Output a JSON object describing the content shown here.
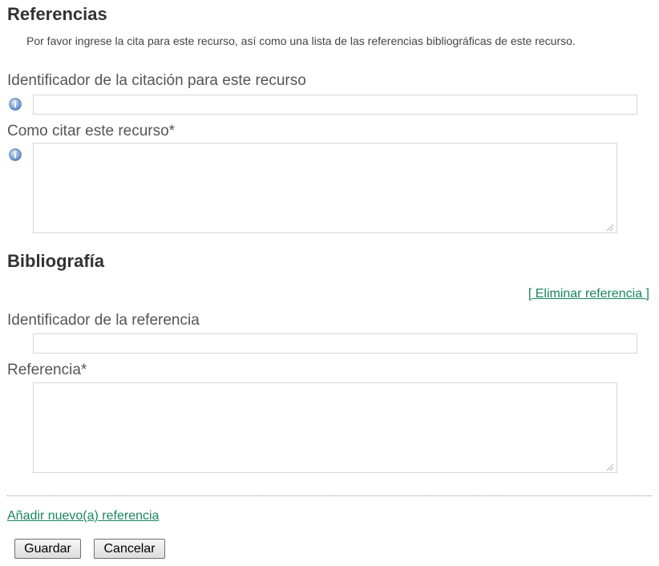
{
  "references": {
    "title": "Referencias",
    "intro": "Por favor ingrese la cita para este recurso, así como una lista de las referencias bibliográficas de este recurso.",
    "citation_id": {
      "label": "Identificador de la citación para este recurso",
      "value": ""
    },
    "how_to_cite": {
      "label": "Como citar este recurso*",
      "value": ""
    }
  },
  "bibliography": {
    "title": "Bibliografía",
    "remove_link": "[ Eliminar referencia ]",
    "reference_id": {
      "label": "Identificador de la referencia",
      "value": ""
    },
    "reference": {
      "label": "Referencia*",
      "value": ""
    },
    "add_link": "Añadir nuevo(a) referencia"
  },
  "buttons": {
    "save": "Guardar",
    "cancel": "Cancelar"
  },
  "icons": {
    "info": "info-icon",
    "resize": "resize-grip-icon"
  },
  "colors": {
    "link": "#17875c",
    "info_icon": "#5b88c4",
    "text": "#333333"
  }
}
